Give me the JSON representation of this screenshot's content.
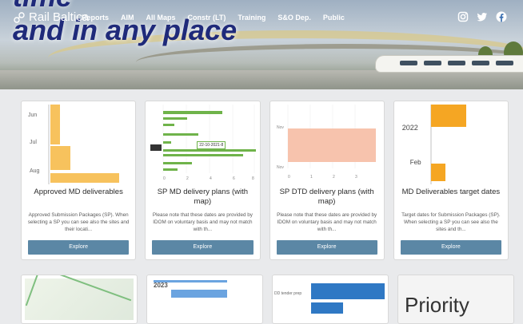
{
  "hero": {
    "slogan_line1": "time",
    "slogan_line2": "and in any place"
  },
  "nav": {
    "brand": "Rail Baltica",
    "links": [
      "Reports",
      "AIM",
      "All Maps",
      "Constr (LT)",
      "Training",
      "S&O Dep.",
      "Public"
    ],
    "social_icons": [
      "instagram-icon",
      "twitter-icon",
      "facebook-icon"
    ]
  },
  "cards": [
    {
      "title": "Approved MD deliverables",
      "description": "Approved Submission Packages (SP). When selecting a SP you can see also the sites and their locati...",
      "button": "Explore",
      "thumb_ticks": [
        "Jun",
        "Jul",
        "Aug"
      ]
    },
    {
      "title": "SP MD delivery plans (with map)",
      "description": "Please note that these dates are provided by IDOM on voluntary basis and may not match with th...",
      "button": "Explore",
      "thumb_callout": "22-10-2021-8"
    },
    {
      "title": "SP DTD delivery plans (with map)",
      "description": "Please note that these dates are provided by IDOM on voluntary basis and may not match with th...",
      "button": "Explore"
    },
    {
      "title": "MD Deliverables target dates",
      "description": "Target dates for Submission Packages (SP). When selecting a SP you can see also the sites and th...",
      "button": "Explore",
      "thumb_ticks": [
        "2022",
        "Feb"
      ]
    }
  ],
  "row2": {
    "card2_tick": "2023",
    "card3_label": "DD tender prep",
    "card4_text": "Priority"
  },
  "colors": {
    "nav_text": "#ffffff",
    "button_bg": "#5b87a5",
    "bar_orange": "#f5a623",
    "bar_green": "#5aa02c",
    "bar_salmon": "#f7c3ad",
    "bar_blue": "#2f78c4",
    "slogan": "#1f2a7a"
  }
}
